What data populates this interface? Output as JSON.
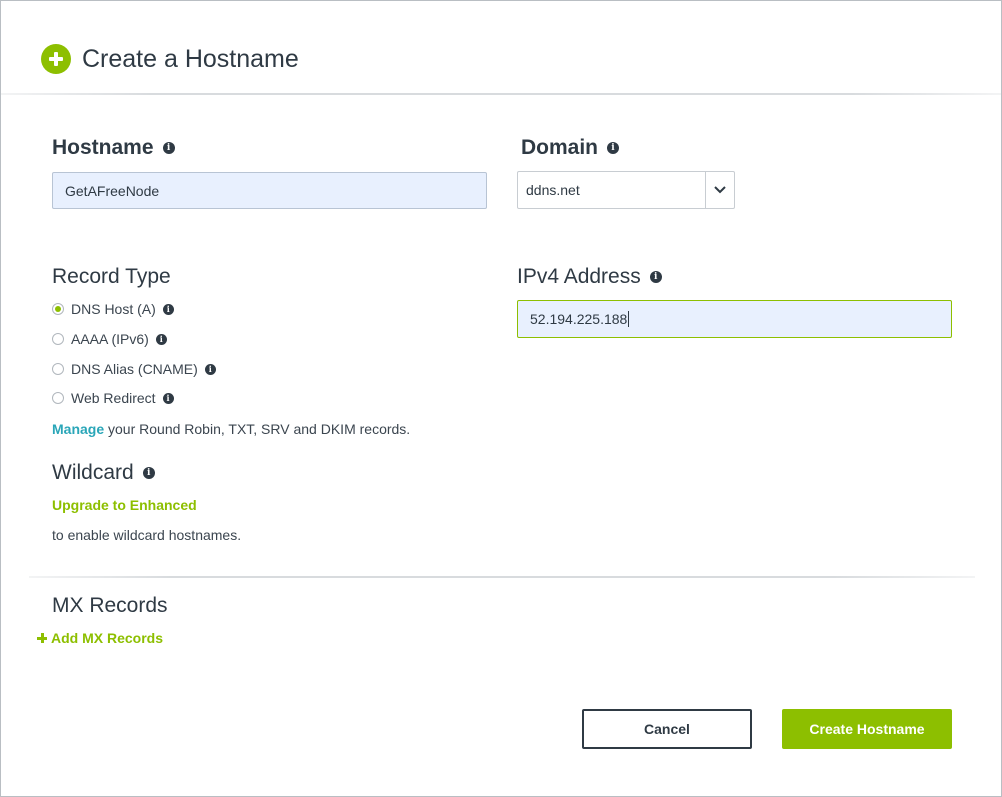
{
  "dialog": {
    "title": "Create a Hostname"
  },
  "hostname": {
    "label": "Hostname",
    "value": "GetAFreeNode"
  },
  "domain": {
    "label": "Domain",
    "selected": "ddns.net"
  },
  "record_type": {
    "label": "Record Type",
    "options": [
      {
        "label": "DNS Host (A)",
        "checked": true
      },
      {
        "label": "AAAA (IPv6)",
        "checked": false
      },
      {
        "label": "DNS Alias (CNAME)",
        "checked": false
      },
      {
        "label": "Web Redirect",
        "checked": false
      }
    ],
    "manage_link": "Manage",
    "manage_text": " your Round Robin, TXT, SRV and DKIM records."
  },
  "ipv4": {
    "label": "IPv4 Address",
    "value": "52.194.225.188"
  },
  "wildcard": {
    "label": "Wildcard",
    "upgrade_link": "Upgrade to Enhanced",
    "note": "to enable wildcard hostnames."
  },
  "mx": {
    "label": "MX Records",
    "add_link": "Add MX Records"
  },
  "actions": {
    "cancel_label": "Cancel",
    "create_label": "Create Hostname"
  },
  "colors": {
    "accent": "#8dbf00",
    "link": "#2aa6b8",
    "text": "#2f3a44",
    "input_bg": "#e8f0fe"
  },
  "icons": [
    "plus-circle-icon",
    "info-icon",
    "chevron-down-icon",
    "plus-icon"
  ]
}
